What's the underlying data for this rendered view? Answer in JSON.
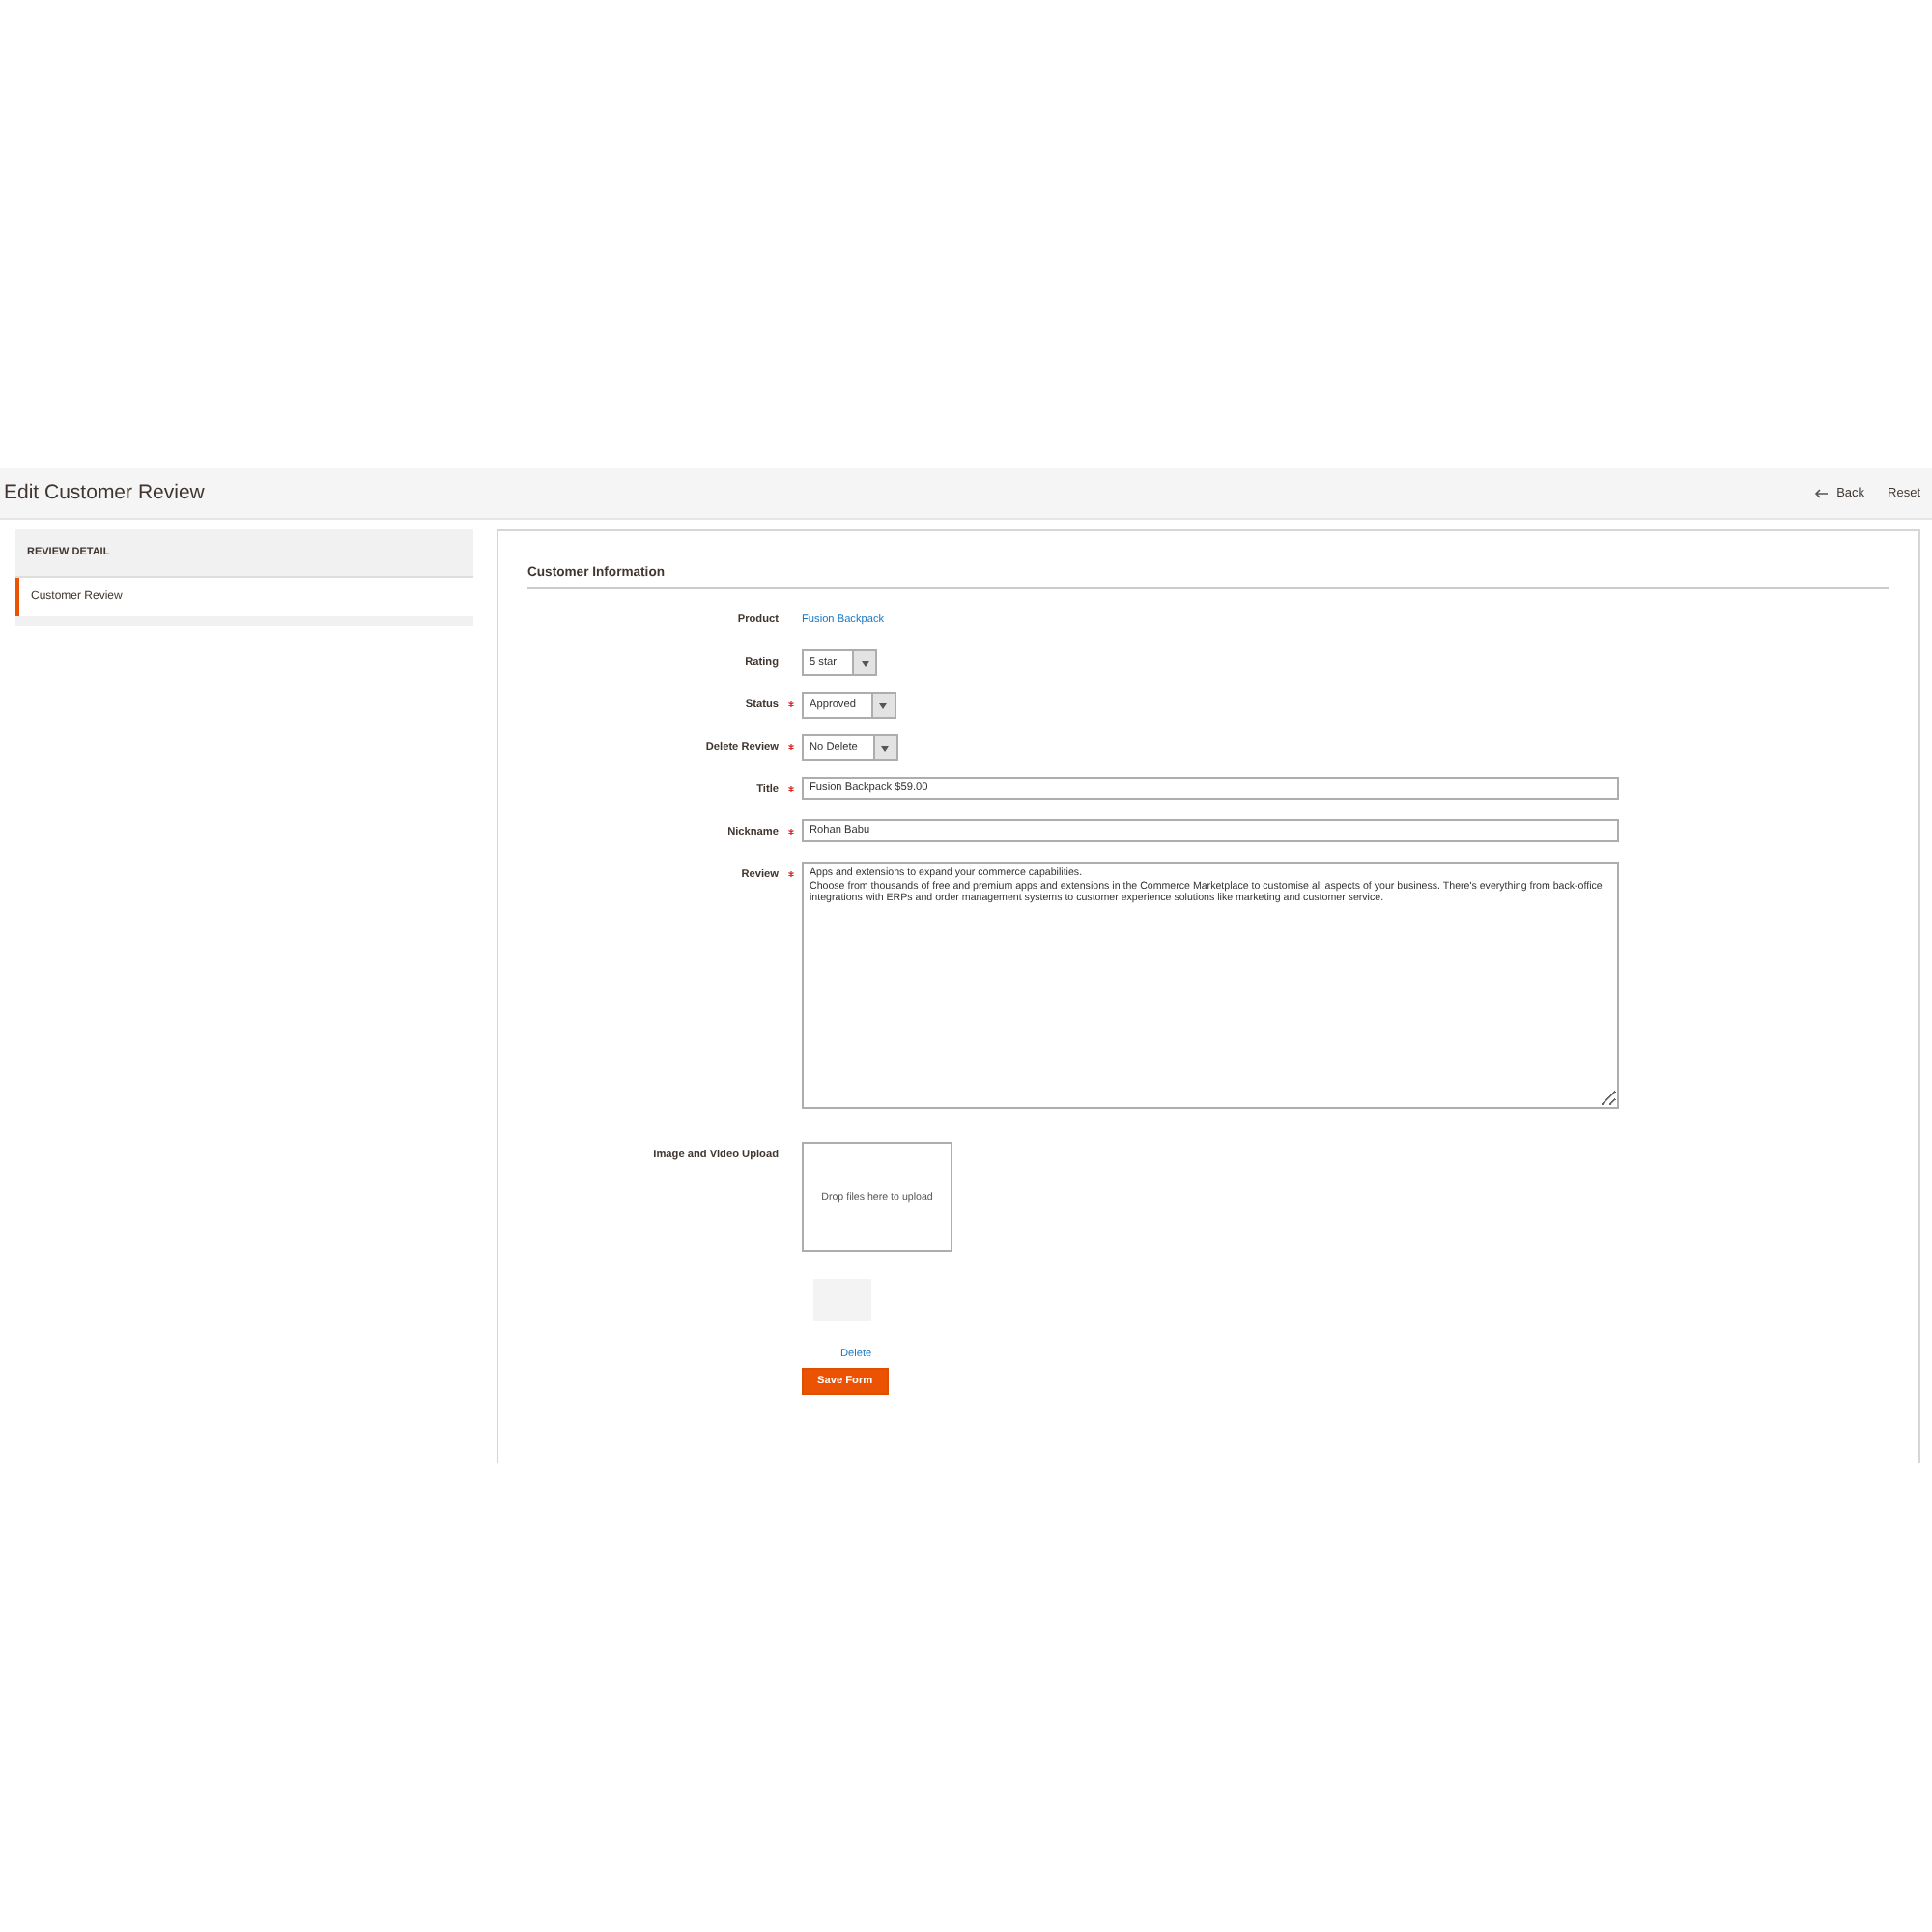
{
  "page": {
    "title": "Edit Customer Review",
    "actions": [
      {
        "kind": "back",
        "label": "Back"
      },
      {
        "kind": "plain",
        "label": "Reset"
      }
    ]
  },
  "sidebar": {
    "heading": "REVIEW DETAIL",
    "items": [
      {
        "label": "Customer Review",
        "selected": true
      }
    ]
  },
  "form": {
    "section_title": "Customer Information",
    "fields": [
      {
        "kind": "link",
        "label": "Product",
        "required": false,
        "value": "Fusion Backpack"
      },
      {
        "kind": "select",
        "label": "Rating",
        "required": false,
        "value": "5 star"
      },
      {
        "kind": "select",
        "label": "Status",
        "required": true,
        "value": "Approved"
      },
      {
        "kind": "select",
        "label": "Delete Review",
        "required": true,
        "value": "No Delete"
      },
      {
        "kind": "text",
        "label": "Title",
        "required": true,
        "value": "Fusion Backpack $59.00"
      },
      {
        "kind": "text",
        "label": "Nickname",
        "required": true,
        "value": "Rohan Babu"
      },
      {
        "kind": "textarea",
        "label": "Review",
        "required": true,
        "value": "Apps and extensions to expand your commerce capabilities.\nChoose from thousands of free and premium apps and extensions in the Commerce Marketplace to customise all aspects of your business. There's everything from back-office integrations with ERPs and order management systems to customer experience solutions like marketing and customer service."
      },
      {
        "kind": "upload",
        "label": "Image and Video Upload",
        "required": false,
        "value": "Drop files here to upload",
        "delete_label": "Delete"
      }
    ],
    "save_label": "Save Form"
  }
}
